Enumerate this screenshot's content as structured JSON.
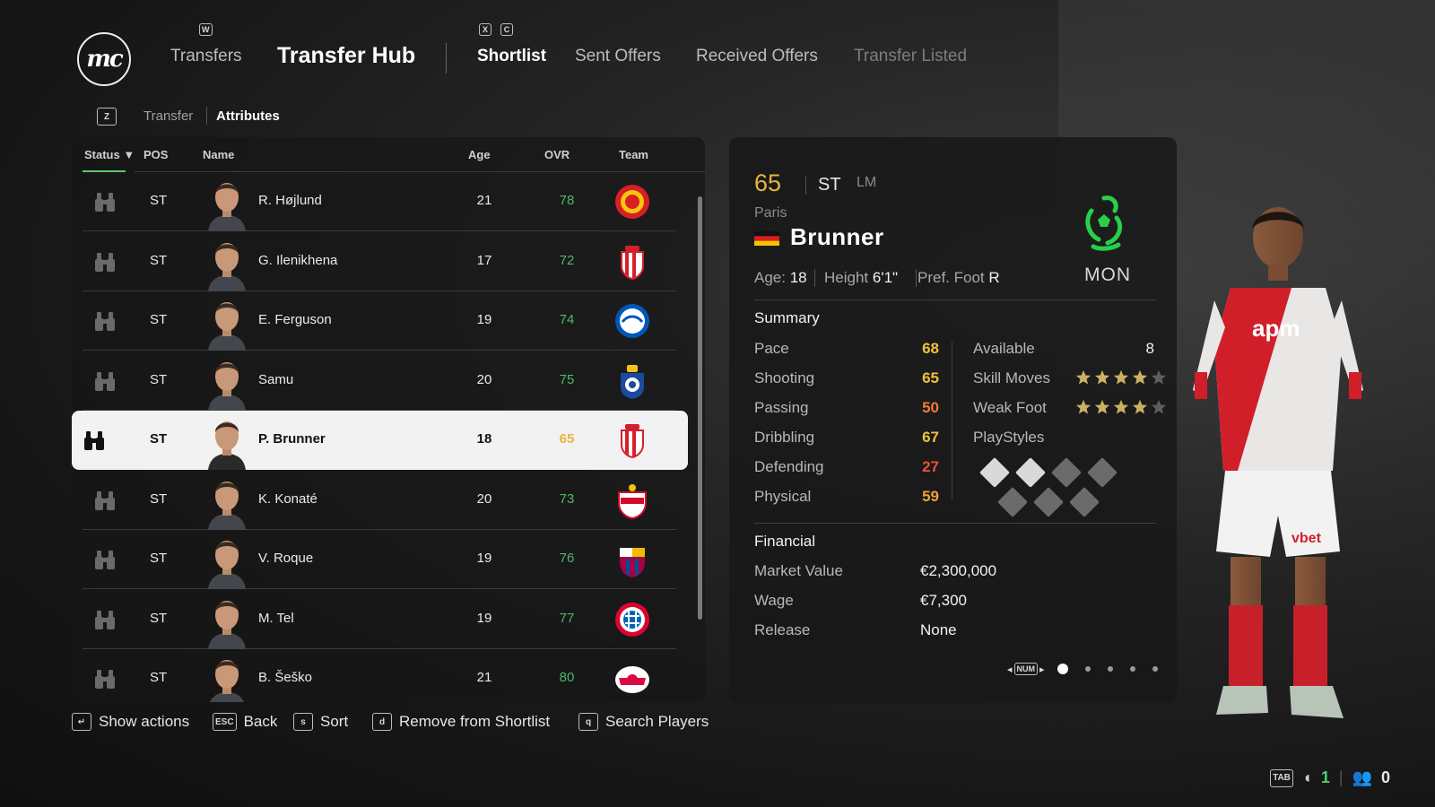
{
  "header": {
    "logo_text": "mc",
    "nav": {
      "transfers": "Transfers",
      "transfer_hub": "Transfer Hub",
      "shortlist": "Shortlist",
      "sent_offers": "Sent Offers",
      "received_offers": "Received Offers",
      "transfer_listed": "Transfer Listed"
    },
    "keys": {
      "w": "W",
      "x": "X",
      "c": "C",
      "z": "Z"
    },
    "breadcrumb": {
      "item1": "Transfer",
      "item2": "Attributes"
    }
  },
  "list": {
    "columns": {
      "status": "Status ▼",
      "pos": "POS",
      "name": "Name",
      "age": "Age",
      "ovr": "OVR",
      "team": "Team"
    },
    "rows": [
      {
        "pos": "ST",
        "name": "R. Højlund",
        "age": "21",
        "ovr": "78",
        "team_icon": "manchester-united-crest",
        "selected": false
      },
      {
        "pos": "ST",
        "name": "G. Ilenikhena",
        "age": "17",
        "ovr": "72",
        "team_icon": "monaco-crest",
        "selected": false
      },
      {
        "pos": "ST",
        "name": "E. Ferguson",
        "age": "19",
        "ovr": "74",
        "team_icon": "brighton-crest",
        "selected": false
      },
      {
        "pos": "ST",
        "name": "Samu",
        "age": "20",
        "ovr": "75",
        "team_icon": "porto-crest",
        "selected": false
      },
      {
        "pos": "ST",
        "name": "P. Brunner",
        "age": "18",
        "ovr": "65",
        "team_icon": "monaco-crest",
        "selected": true
      },
      {
        "pos": "ST",
        "name": "K. Konaté",
        "age": "20",
        "ovr": "73",
        "team_icon": "salzburg-crest",
        "selected": false
      },
      {
        "pos": "ST",
        "name": "V. Roque",
        "age": "19",
        "ovr": "76",
        "team_icon": "barcelona-crest",
        "selected": false
      },
      {
        "pos": "ST",
        "name": "M. Tel",
        "age": "19",
        "ovr": "77",
        "team_icon": "bayern-crest",
        "selected": false
      },
      {
        "pos": "ST",
        "name": "B. Šeško",
        "age": "21",
        "ovr": "80",
        "team_icon": "leipzig-crest",
        "selected": false
      }
    ]
  },
  "hints": [
    {
      "key": "↵",
      "label": "Show actions"
    },
    {
      "key": "ESC",
      "label": "Back"
    },
    {
      "key": "s",
      "label": "Sort"
    },
    {
      "key": "d",
      "label": "Remove from Shortlist"
    },
    {
      "key": "q",
      "label": "Search Players"
    }
  ],
  "detail": {
    "ovr": "65",
    "position": "ST",
    "alt_position": "LM",
    "first_name": "Paris",
    "last_name": "Brunner",
    "nationality_icon": "germany-flag",
    "club_code": "MON",
    "club_icon": "club-crest",
    "info": {
      "age_label": "Age:",
      "age": "18",
      "height_label": "Height",
      "height": "6'1\"",
      "foot_label": "Pref. Foot",
      "foot": "R"
    },
    "summary_title": "Summary",
    "stats": [
      {
        "label": "Pace",
        "value": "68",
        "color": "#f0c23a"
      },
      {
        "label": "Shooting",
        "value": "65",
        "color": "#f0c23a"
      },
      {
        "label": "Passing",
        "value": "50",
        "color": "#f07a3a"
      },
      {
        "label": "Dribbling",
        "value": "67",
        "color": "#f0c23a"
      },
      {
        "label": "Defending",
        "value": "27",
        "color": "#e8503a"
      },
      {
        "label": "Physical",
        "value": "59",
        "color": "#f0a03a"
      }
    ],
    "available_label": "Available",
    "available_value": "8",
    "skill_moves_label": "Skill Moves",
    "skill_moves_stars": 4,
    "weak_foot_label": "Weak Foot",
    "weak_foot_stars": 4,
    "playstyles_label": "PlayStyles",
    "financial_title": "Financial",
    "financial": [
      {
        "label": "Market Value",
        "value": "€2,300,000"
      },
      {
        "label": "Wage",
        "value": "€7,300"
      },
      {
        "label": "Release",
        "value": "None"
      }
    ],
    "pager_key": "NUM",
    "page_count": 5,
    "active_page": 1
  },
  "status_bar": {
    "key": "TAB",
    "count1": "1",
    "count2": "0"
  },
  "colors": {
    "ovr_green": "#4fb86a",
    "ovr_yellow": "#e8b53a",
    "accent_green": "#5ec86c"
  }
}
